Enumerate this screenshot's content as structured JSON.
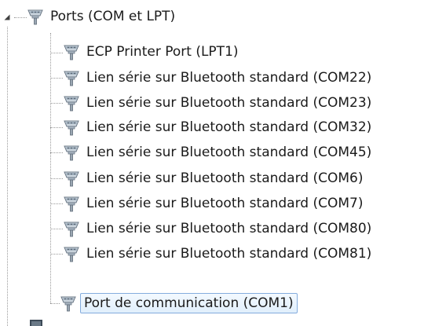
{
  "category": {
    "label": "Ports (COM et LPT)",
    "icon": "port-icon",
    "expanded": true
  },
  "devices": [
    {
      "label": "ECP Printer Port (LPT1)",
      "icon": "port-icon"
    },
    {
      "label": "Lien série sur Bluetooth standard (COM22)",
      "icon": "port-icon"
    },
    {
      "label": "Lien série sur Bluetooth standard (COM23)",
      "icon": "port-icon"
    },
    {
      "label": "Lien série sur Bluetooth standard (COM32)",
      "icon": "port-icon"
    },
    {
      "label": "Lien série sur Bluetooth standard (COM45)",
      "icon": "port-icon"
    },
    {
      "label": "Lien série sur Bluetooth standard (COM6)",
      "icon": "port-icon"
    },
    {
      "label": "Lien série sur Bluetooth standard (COM7)",
      "icon": "port-icon"
    },
    {
      "label": "Lien série sur Bluetooth standard (COM80)",
      "icon": "port-icon"
    },
    {
      "label": "Lien série sur Bluetooth standard (COM81)",
      "icon": "port-icon"
    },
    {
      "label": "Port de communication (COM1)",
      "icon": "port-icon",
      "selected": true
    }
  ],
  "colors": {
    "selection_border": "#84acdd",
    "selection_fill": "#e1effc",
    "connector": "#9a9a9a",
    "text": "#1a1a1a"
  }
}
